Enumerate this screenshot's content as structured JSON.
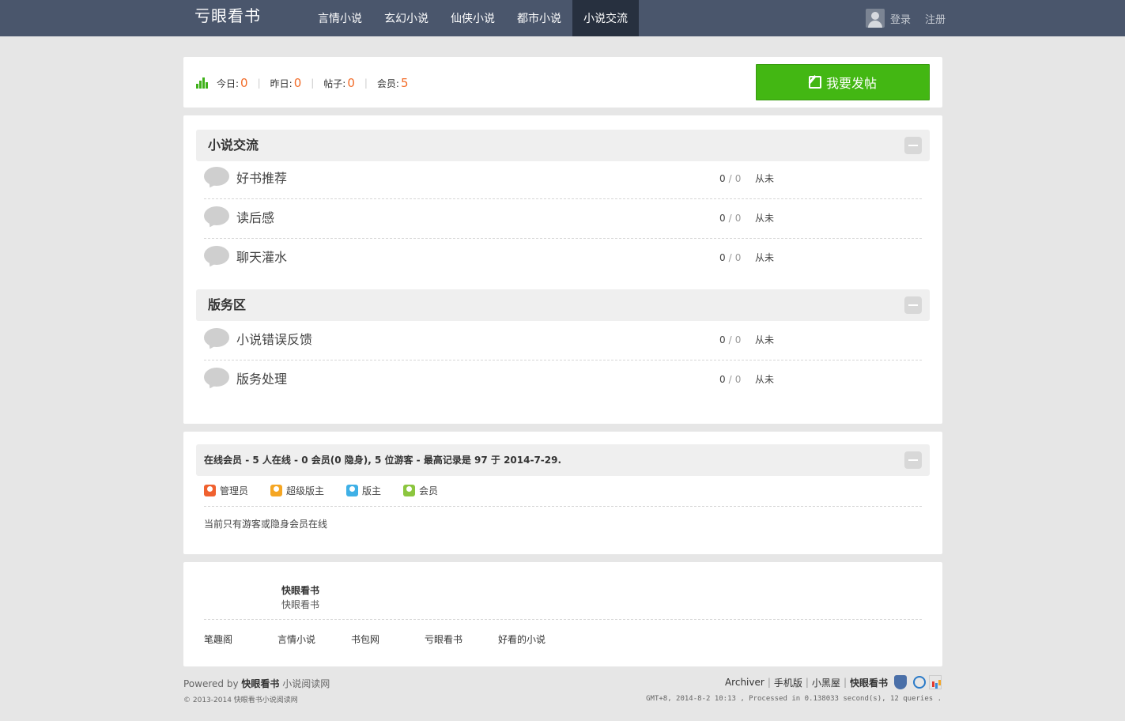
{
  "header": {
    "logo": "亏眼看书",
    "nav": [
      "言情小说",
      "玄幻小说",
      "仙侠小说",
      "都市小说",
      "小说交流"
    ],
    "active_index": 4,
    "login": "登录",
    "register": "注册"
  },
  "stats": {
    "today_label": "今日:",
    "today": "0",
    "yesterday_label": "昨日:",
    "yesterday": "0",
    "posts_label": "帖子:",
    "posts": "0",
    "members_label": "会员:",
    "members": "5",
    "sep": "|",
    "post_button": "我要发帖"
  },
  "sections": [
    {
      "title": "小说交流",
      "forums": [
        {
          "name": "好书推荐",
          "threads": "0",
          "sep": "/",
          "posts": "0",
          "last": "从未"
        },
        {
          "name": "读后感",
          "threads": "0",
          "sep": "/",
          "posts": "0",
          "last": "从未"
        },
        {
          "name": "聊天灌水",
          "threads": "0",
          "sep": "/",
          "posts": "0",
          "last": "从未"
        }
      ]
    },
    {
      "title": "版务区",
      "forums": [
        {
          "name": "小说错误反馈",
          "threads": "0",
          "sep": "/",
          "posts": "0",
          "last": "从未"
        },
        {
          "name": "版务处理",
          "threads": "0",
          "sep": "/",
          "posts": "0",
          "last": "从未"
        }
      ]
    }
  ],
  "online": {
    "title": "在线会员",
    "summary": " - 5 人在线 - 0 会员(0 隐身), 5 位游客 - 最高记录是 97 于 2014-7-29.",
    "legend": [
      {
        "label": "管理员",
        "color": "#f0612f"
      },
      {
        "label": "超级版主",
        "color": "#f5a623"
      },
      {
        "label": "版主",
        "color": "#3fb0e6"
      },
      {
        "label": "会员",
        "color": "#8cc63f"
      }
    ],
    "note": "当前只有游客或隐身会员在线"
  },
  "footer_panel": {
    "name": "快眼看书",
    "sub": "快眼看书",
    "links": [
      "笔趣阁",
      "言情小说",
      "书包网",
      "亏眼看书",
      "好看的小说"
    ]
  },
  "page_footer": {
    "powered_prefix": "Powered by ",
    "powered_name": "快眼看书",
    "powered_suffix": " 小说阅读网",
    "copyright": "© 2013-2014  快眼看书小说阅读网",
    "right_links": [
      "Archiver",
      "手机版",
      "小黑屋"
    ],
    "right_bold": "快眼看书",
    "sep": "|",
    "stats_line": "GMT+8, 2014-8-2 10:13 , Processed in 0.138033 second(s), 12 queries ."
  },
  "colors": {
    "topbar": "#4a566c",
    "nav_active": "#27303f",
    "accent_green": "#43b713",
    "stat_orange": "#f26c29"
  }
}
